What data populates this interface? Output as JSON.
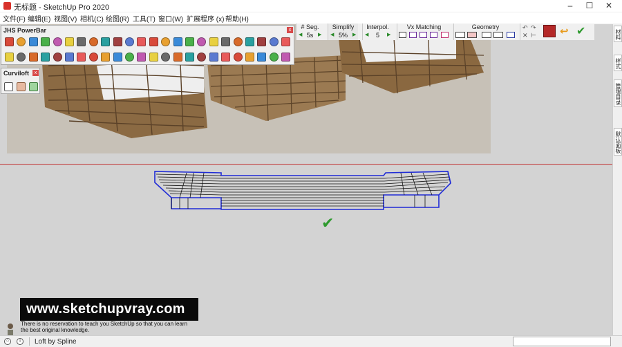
{
  "window": {
    "title": "无标题 - SketchUp Pro 2020",
    "minimize_icon": "minimize-icon",
    "maximize_icon": "maximize-icon",
    "close_icon": "close-icon"
  },
  "menubar": {
    "items": [
      {
        "label": "文件(F)"
      },
      {
        "label": "编辑(E)"
      },
      {
        "label": "视图(V)"
      },
      {
        "label": "相机(C)"
      },
      {
        "label": "绘图(R)"
      },
      {
        "label": "工具(T)"
      },
      {
        "label": "窗口(W)"
      },
      {
        "label": "扩展程序 (x)"
      },
      {
        "label": "帮助(H)"
      }
    ]
  },
  "curviloft_toolbar": {
    "seg_label": "# Seg.",
    "seg_value": "5s",
    "simplify_label": "Simplify",
    "simplify_value": "5%",
    "interpol_label": "Interpol.",
    "interpol_value": "5",
    "vx_label": "Vx Matching",
    "geometry_label": "Geometry"
  },
  "powerbar": {
    "title": "JHS PowerBar",
    "row1_count": 24,
    "row2_count": 24
  },
  "curviloft_panel": {
    "title": "Curviloft"
  },
  "side_tabs": [
    {
      "label": "材料"
    },
    {
      "label": "样式"
    },
    {
      "label": "管理目录"
    },
    {
      "label": "默认面板"
    }
  ],
  "watermark": {
    "url": "www.sketchupvray.com",
    "line1": "There is no reservation to teach you SketchUp so that you can learn",
    "line2": "the best original knowledge."
  },
  "status": {
    "text": "Loft by Spline"
  },
  "colors": {
    "wireframe_blue": "#1f2bd6",
    "horizon_red": "#c03030",
    "check_green": "#2e9a2e"
  }
}
